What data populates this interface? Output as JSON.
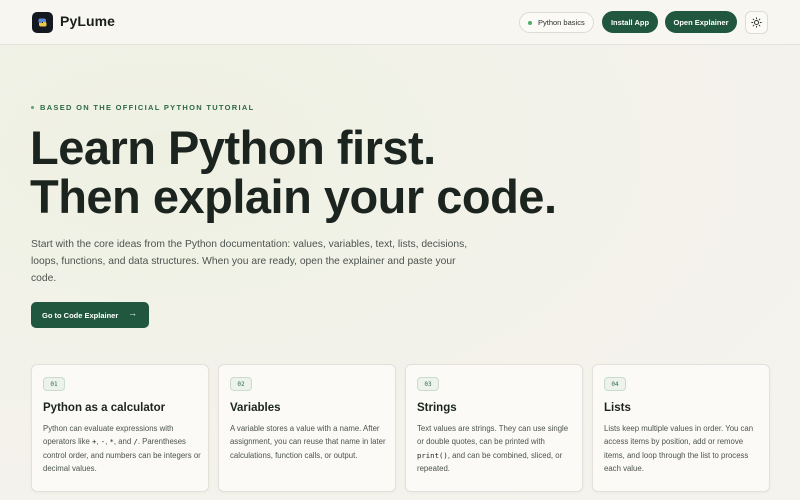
{
  "header": {
    "brand": "PyLume",
    "logo_icon": "pylume-logo-icon",
    "pill_label": "Python basics",
    "install_label": "Install App",
    "open_label": "Open Explainer",
    "theme_icon": "sun-icon"
  },
  "hero": {
    "eyebrow": "BASED ON THE OFFICIAL PYTHON TUTORIAL",
    "headline_line1": "Learn Python first.",
    "headline_line2": "Then explain your code.",
    "lead": "Start with the core ideas from the Python documentation: values, variables, text, lists, decisions, loops, functions, and data structures. When you are ready, open the explainer and paste your code.",
    "cta_label": "Go to Code Explainer",
    "cta_arrow": "→"
  },
  "cards": [
    {
      "number": "01",
      "title": "Python as a calculator",
      "body_a": "Python can evaluate expressions with operators like ",
      "op1": "+",
      "sep1": ", ",
      "op2": "-",
      "sep2": ", ",
      "op3": "*",
      "sep3": ", and ",
      "op4": "/",
      "body_b": ". Parentheses control order, and numbers can be integers or decimal values."
    },
    {
      "number": "02",
      "title": "Variables",
      "body": "A variable stores a value with a name. After assignment, you can reuse that name in later calculations, function calls, or output."
    },
    {
      "number": "03",
      "title": "Strings",
      "body_a": "Text values are strings. They can use single or double quotes, can be printed with ",
      "code": "print()",
      "body_b": ", and can be combined, sliced, or repeated."
    },
    {
      "number": "04",
      "title": "Lists",
      "body": "Lists keep multiple values in order. You can access items by position, add or remove items, and loop through the list to process each value."
    }
  ]
}
